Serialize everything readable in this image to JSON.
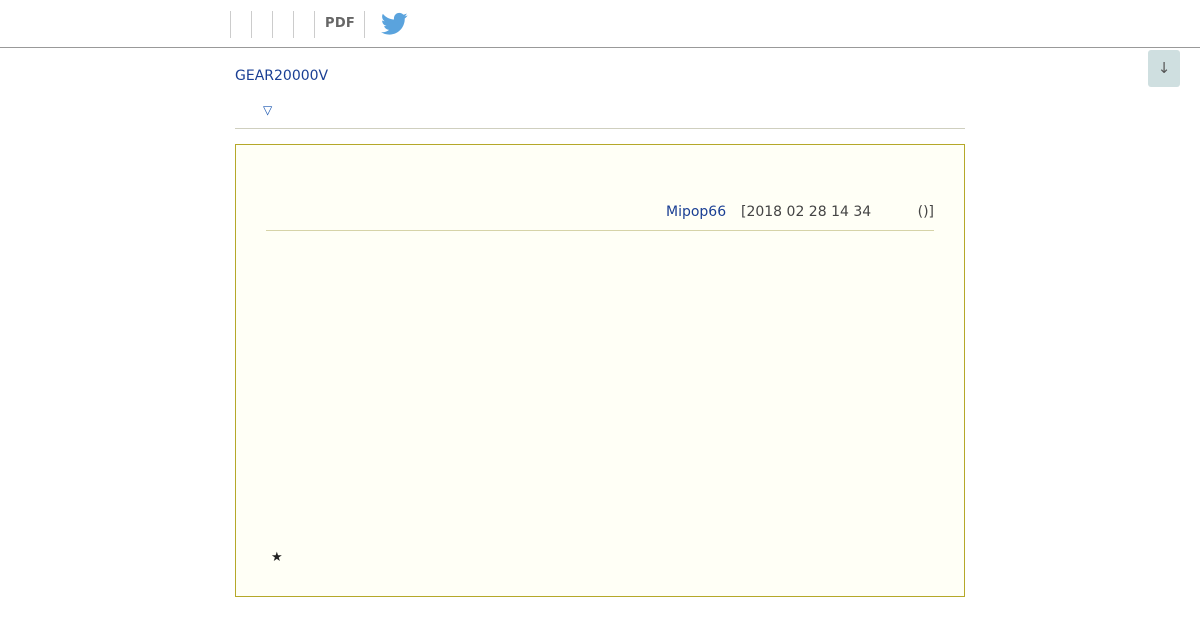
{
  "toolbar": {
    "pdf_label": "PDF",
    "twitter_icon": "twitter-bird-icon",
    "twitter_color": "#5aa3dd"
  },
  "scroll_button": {
    "label": "↓"
  },
  "product": {
    "name": "GEAR20000V",
    "expand_glyph": "▽"
  },
  "review": {
    "author": "Mipop66",
    "date": "[2018 02 28 14 34",
    "count": "()]",
    "rating_glyph": "★"
  },
  "colors": {
    "link": "#1a3f94",
    "box_border": "#b5a829",
    "box_background": "#fffff6"
  }
}
